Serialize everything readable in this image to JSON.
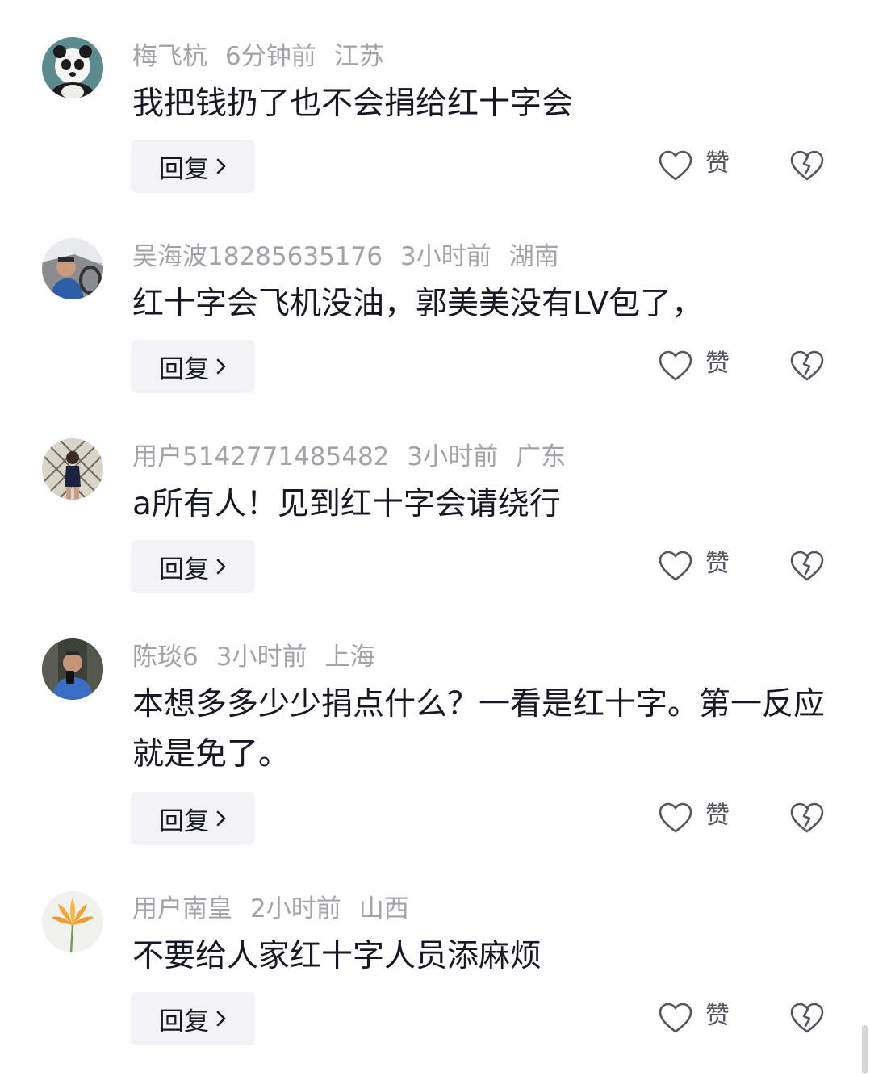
{
  "like_label": "赞",
  "reply_label": "回复",
  "icons": {
    "like": "heart-outline-icon",
    "dislike": "broken-heart-icon",
    "reply_chevron": "chevron-right-icon"
  },
  "comments": [
    {
      "username": "梅飞杭",
      "time": "6分钟前",
      "location": "江苏",
      "text": "我把钱扔了也不会捐给红十字会",
      "avatar": "panda"
    },
    {
      "username": "吴海波18285635176",
      "time": "3小时前",
      "location": "湖南",
      "text": "红十字会飞机没油，郭美美没有LV包了，",
      "avatar": "man-in-car"
    },
    {
      "username": "用户5142771485482",
      "time": "3小时前",
      "location": "广东",
      "text": "a所有人！见到红十字会请绕行",
      "avatar": "woman-window"
    },
    {
      "username": "陈琰6",
      "time": "3小时前",
      "location": "上海",
      "text": "本想多多少少捐点什么？一看是红十字。第一反应就是免了。",
      "avatar": "man-selfie"
    },
    {
      "username": "用户南皇",
      "time": "2小时前",
      "location": "山西",
      "text": "不要给人家红十字人员添麻烦",
      "avatar": "orange-flower"
    }
  ]
}
